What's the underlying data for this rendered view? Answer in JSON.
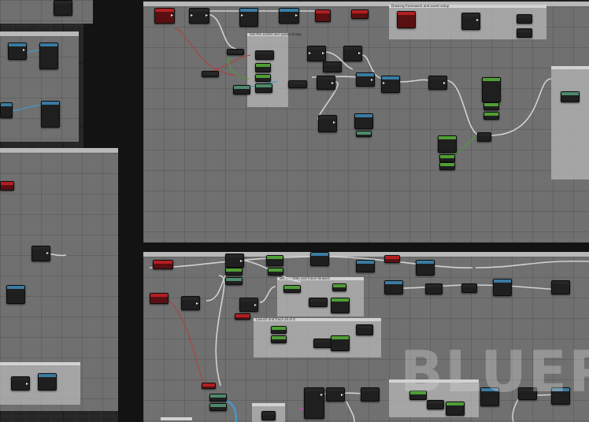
{
  "editor": {
    "watermark": "BLUEP"
  },
  "comments": [
    {
      "id": "top-right",
      "title": "Drawing framework and event setup"
    },
    {
      "id": "mid-left",
      "title": "Get the socket and spawn things"
    },
    {
      "id": "bottom-mid-1",
      "title": "Set the state and move forward"
    },
    {
      "id": "bottom-mid-2",
      "title": "Launch and trace all of it"
    }
  ],
  "colors": {
    "graph_bg": "#262626",
    "comment_body": "#767676",
    "exec_wire": "#e6e6e6",
    "object_wire": "#3fa0d0",
    "event_header": "#b21f22",
    "function_header": "#3a7ba2",
    "pure_header": "#4f9e35"
  }
}
